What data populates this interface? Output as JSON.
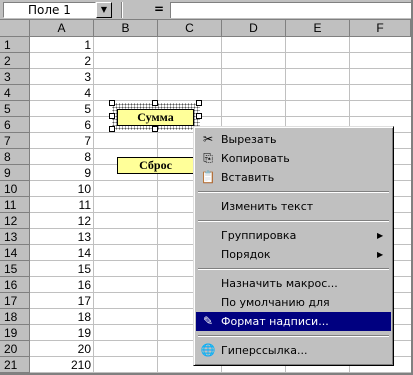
{
  "formula_bar": {
    "name_box": "Поле 1",
    "eq_symbol": "=",
    "formula": ""
  },
  "columns": [
    "A",
    "B",
    "C",
    "D",
    "E",
    "F"
  ],
  "rows": [
    {
      "num": "1",
      "a": "1"
    },
    {
      "num": "2",
      "a": "2"
    },
    {
      "num": "3",
      "a": "3"
    },
    {
      "num": "4",
      "a": "4"
    },
    {
      "num": "5",
      "a": "5"
    },
    {
      "num": "6",
      "a": "6"
    },
    {
      "num": "7",
      "a": "7"
    },
    {
      "num": "8",
      "a": "8"
    },
    {
      "num": "9",
      "a": "9"
    },
    {
      "num": "10",
      "a": "10"
    },
    {
      "num": "11",
      "a": "11"
    },
    {
      "num": "12",
      "a": "12"
    },
    {
      "num": "13",
      "a": "13"
    },
    {
      "num": "14",
      "a": "14"
    },
    {
      "num": "15",
      "a": "15"
    },
    {
      "num": "16",
      "a": "16"
    },
    {
      "num": "17",
      "a": "17"
    },
    {
      "num": "18",
      "a": "18"
    },
    {
      "num": "19",
      "a": "19"
    },
    {
      "num": "20",
      "a": "20"
    },
    {
      "num": "21",
      "a": "210"
    }
  ],
  "sheet_buttons": {
    "sum": "Сумма",
    "reset": "Сброс"
  },
  "context_menu": {
    "items": [
      {
        "label": "Вырезать",
        "icon": "scissors-icon"
      },
      {
        "label": "Копировать",
        "icon": "copy-icon"
      },
      {
        "label": "Вставить",
        "icon": "paste-icon"
      },
      {
        "label": "Изменить текст"
      },
      {
        "label": "Группировка",
        "submenu": true
      },
      {
        "label": "Порядок",
        "submenu": true
      },
      {
        "label": "Назначить макрос..."
      },
      {
        "label": "По умолчанию для автофигур"
      },
      {
        "label": "Формат надписи...",
        "icon": "format-textbox-icon",
        "highlighted": true
      },
      {
        "label": "Гиперссылка...",
        "icon": "hyperlink-globe-icon"
      }
    ]
  },
  "colors": {
    "chrome": "#c0c0c0",
    "highlight": "#000080",
    "button_fill": "#ffff99"
  }
}
